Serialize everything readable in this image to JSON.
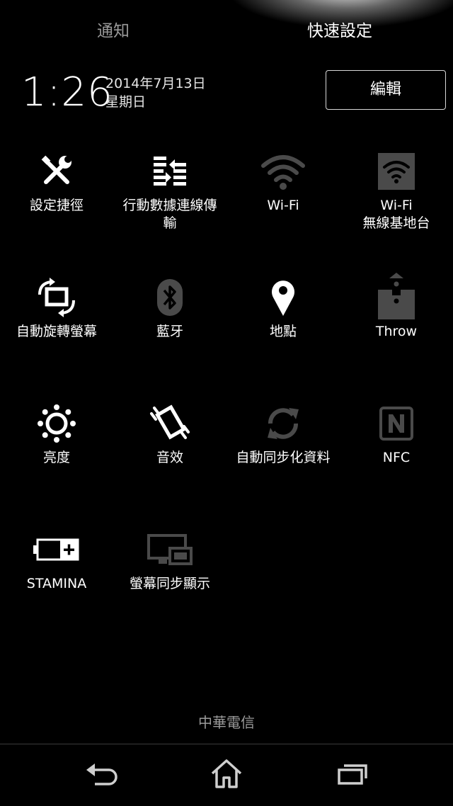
{
  "tabs": {
    "notifications": "通知",
    "quick_settings": "快速設定"
  },
  "header": {
    "time": "1:26",
    "date": "2014年7月13日",
    "weekday": "星期日",
    "edit_label": "編輯"
  },
  "tiles": [
    {
      "label": "設定捷徑",
      "icon": "settings-tools-icon",
      "state": "on"
    },
    {
      "label": "行動數據連線傳\n輸",
      "icon": "mobile-data-icon",
      "state": "on"
    },
    {
      "label": "Wi-Fi",
      "icon": "wifi-icon",
      "state": "off"
    },
    {
      "label": "Wi-Fi\n無線基地台",
      "icon": "wifi-hotspot-icon",
      "state": "off"
    },
    {
      "label": "自動旋轉螢幕",
      "icon": "auto-rotate-icon",
      "state": "on"
    },
    {
      "label": "藍牙",
      "icon": "bluetooth-icon",
      "state": "off"
    },
    {
      "label": "地點",
      "icon": "location-icon",
      "state": "on"
    },
    {
      "label": "Throw",
      "icon": "throw-icon",
      "state": "off"
    },
    {
      "label": "亮度",
      "icon": "brightness-icon",
      "state": "on"
    },
    {
      "label": "音效",
      "icon": "vibrate-icon",
      "state": "on"
    },
    {
      "label": "自動同步化資料",
      "icon": "sync-icon",
      "state": "off"
    },
    {
      "label": "NFC",
      "icon": "nfc-icon",
      "state": "off"
    },
    {
      "label": "STAMINA",
      "icon": "stamina-battery-icon",
      "state": "on"
    },
    {
      "label": "螢幕同步顯示",
      "icon": "screen-mirroring-icon",
      "state": "off"
    }
  ],
  "footer": {
    "carrier": "中華電信"
  },
  "nav": {
    "back": "back-icon",
    "home": "home-icon",
    "recents": "recent-apps-icon"
  },
  "colors": {
    "active_icon": "#ffffff",
    "inactive_icon": "#4a4a4a",
    "inactive_tab": "#9a9a9a"
  }
}
